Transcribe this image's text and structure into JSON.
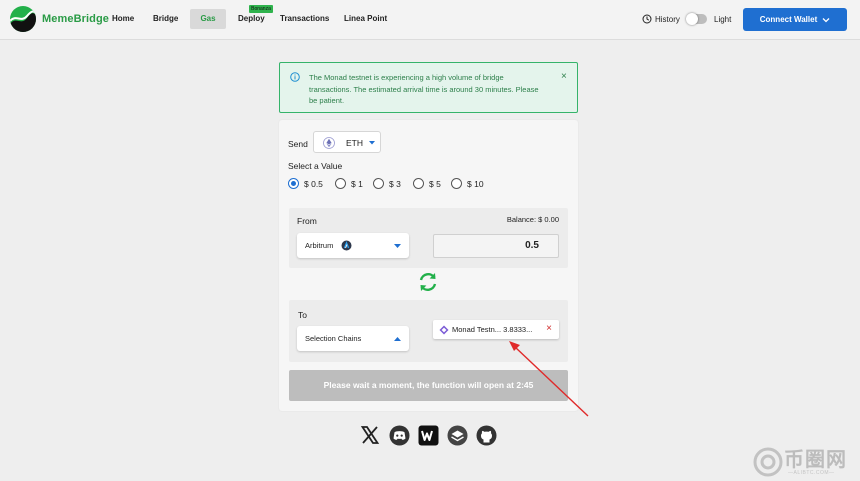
{
  "header": {
    "brand": "MemeBridge",
    "nav": [
      {
        "label": "Home"
      },
      {
        "label": "Bridge"
      },
      {
        "label": "Gas"
      },
      {
        "label": "Deploy"
      },
      {
        "label": "Transactions"
      },
      {
        "label": "Linea Point"
      }
    ],
    "deploy_badge": "Bonanza",
    "history_label": "History",
    "theme_label": "Light",
    "theme_toggle_on": false,
    "connect_label": "Connect Wallet"
  },
  "notice": {
    "message": "The Monad testnet is experiencing a high volume of bridge transactions. The estimated arrival time is around 30 minutes. Please be patient.",
    "close_glyph": "×"
  },
  "form": {
    "send_label": "Send",
    "token": "ETH",
    "select_value_label": "Select a Value",
    "values": [
      {
        "label": "$ 0.5",
        "selected": true
      },
      {
        "label": "$ 1",
        "selected": false
      },
      {
        "label": "$ 3",
        "selected": false
      },
      {
        "label": "$ 5",
        "selected": false
      },
      {
        "label": "$ 10",
        "selected": false
      }
    ],
    "from_label": "From",
    "balance": "Balance: $ 0.00",
    "from_chain": "Arbitrum",
    "amount": "0.5",
    "to_label": "To",
    "to_chain_placeholder": "Selection Chains",
    "to_chip": "Monad Testn... 3.8333...",
    "chip_close_glyph": "×",
    "wait_button": "Please wait a moment, the function will open at 2:45"
  },
  "socials": [
    {
      "icon": "x-icon"
    },
    {
      "icon": "discord-icon"
    },
    {
      "icon": "w-icon"
    },
    {
      "icon": "layers-icon"
    },
    {
      "icon": "github-icon"
    }
  ],
  "watermark": {
    "text": "币圈网",
    "sub": "—ALIBTC.COM—"
  },
  "colors": {
    "accent": "#1f6fd1",
    "brand_green": "#2a9b46",
    "notice_bg": "#e4f4ec",
    "notice_border": "#35b36a",
    "disabled": "#bdbdbd",
    "annotation_red": "#e02a2a"
  }
}
